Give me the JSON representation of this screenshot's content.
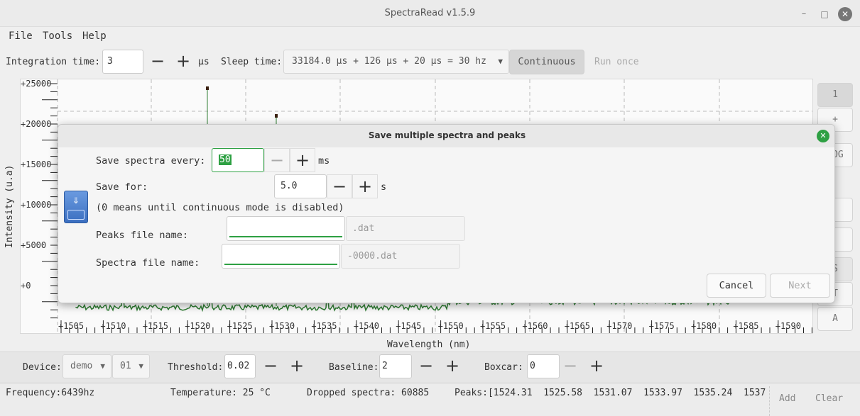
{
  "window": {
    "title": "SpectraRead v1.5.9",
    "controls": [
      "minimize",
      "maximize",
      "close"
    ]
  },
  "menu": [
    "File",
    "Tools",
    "Help"
  ],
  "toolbar": {
    "integration_label": "Integration time:",
    "integration_value": "3",
    "minus": "−",
    "plus": "+",
    "integration_unit": "µs",
    "sleep_label": "Sleep time:",
    "sleep_value": "33184.0 µs + 126 µs + 20 µs = 30 hz",
    "continuous": "Continuous",
    "run_once": "Run once"
  },
  "plot": {
    "ylabel": "Intensity (u.a)",
    "yticks": [
      "+25000",
      "+20000",
      "+15000",
      "+10000",
      "+5000",
      "+0"
    ],
    "xticks": [
      "+1505",
      "+1510",
      "+1515",
      "+1520",
      "+1525",
      "+1530",
      "+1535",
      "+1540",
      "+1545",
      "+1550",
      "+1555",
      "+1560",
      "+1565",
      "+1570",
      "+1575",
      "+1580",
      "+1585",
      "+1590",
      "+1595"
    ],
    "xlabel": "Wavelength (nm)",
    "trace_color": "#2e7d32"
  },
  "side_buttons": [
    "1",
    "+",
    "LOG",
    "",
    "",
    "S",
    "T",
    "A"
  ],
  "dialog": {
    "title": "Save multiple spectra and peaks",
    "save_every_label": "Save spectra every:",
    "save_every_value": "50",
    "save_every_unit": "ms",
    "save_for_label": "Save for:",
    "save_for_value": "5.0",
    "save_for_unit": "s",
    "note": "(0 means until continuous mode is disabled)",
    "peaks_label": "Peaks file name:",
    "peaks_value": "",
    "peaks_suffix": ".dat",
    "spectra_label": "Spectra file name:",
    "spectra_value": "",
    "spectra_suffix": "-0000.dat",
    "cancel": "Cancel",
    "next": "Next",
    "accent": "#2ea043"
  },
  "controls": {
    "device_label": "Device:",
    "device_value": "demo",
    "device_index": "01",
    "threshold_label": "Threshold:",
    "threshold_value": "0.02",
    "baseline_label": "Baseline:",
    "baseline_value": "2",
    "boxcar_label": "Boxcar:",
    "boxcar_value": "0"
  },
  "status": {
    "frequency": "Frequency:6439hz",
    "temperature": "Temperature: 25 °C",
    "dropped": "Dropped spectra: 60885",
    "peaks": "Peaks:[1524.31  1525.58  1531.07  1533.97  1535.24  1537",
    "add": "Add",
    "clear": "Clear"
  }
}
